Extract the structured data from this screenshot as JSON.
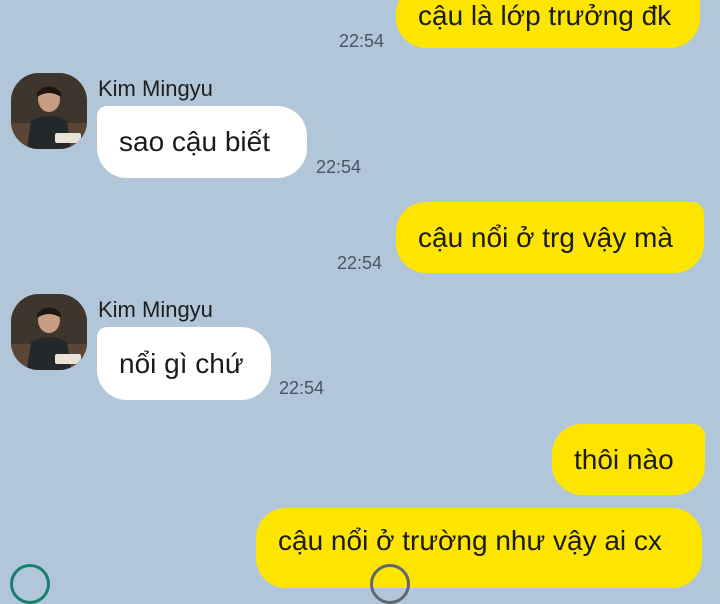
{
  "messages": [
    {
      "side": "me",
      "text": "cậu là lớp trưởng đk",
      "time": "22:54"
    },
    {
      "side": "them",
      "sender": "Kim Mingyu",
      "text": "sao cậu biết",
      "time": "22:54"
    },
    {
      "side": "me",
      "text": "cậu nổi ở trg vậy mà",
      "time": "22:54"
    },
    {
      "side": "them",
      "sender": "Kim Mingyu",
      "text": "nổi gì chứ",
      "time": "22:54"
    },
    {
      "side": "me",
      "text": "thôi nào"
    },
    {
      "side": "me",
      "text": "cậu nổi ở trường như vậy ai cx"
    }
  ],
  "colors": {
    "background": "#b2c6d9",
    "my_bubble": "#fee500",
    "their_bubble": "#ffffff"
  },
  "icons": [
    "avatar-photo",
    "emoji-button-icon",
    "attach-icon"
  ]
}
